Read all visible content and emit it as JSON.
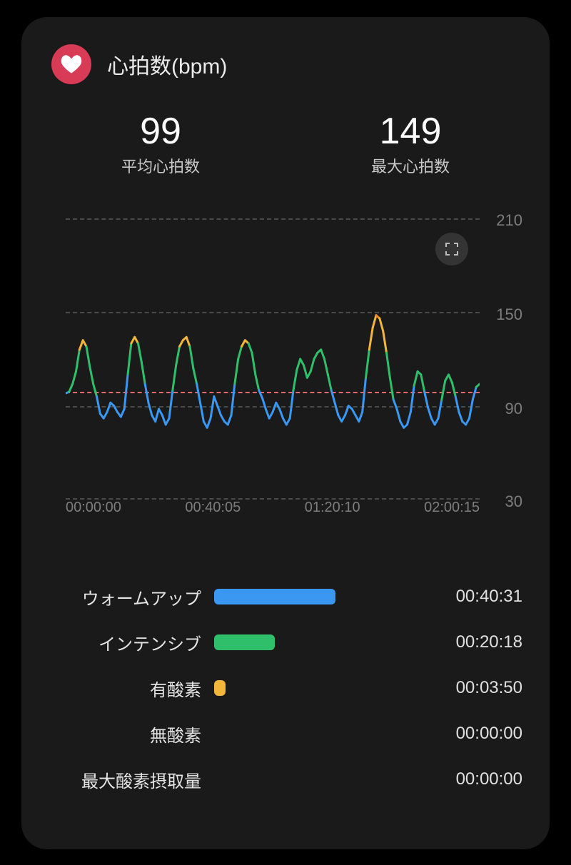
{
  "header": {
    "icon": "heart-icon",
    "title": "心拍数(bpm)"
  },
  "stats": {
    "avg": {
      "value": "99",
      "label": "平均心拍数"
    },
    "max": {
      "value": "149",
      "label": "最大心拍数"
    }
  },
  "chart_data": {
    "type": "line",
    "title": "",
    "xlabel": "",
    "ylabel": "",
    "ylim": [
      30,
      210
    ],
    "yticks": [
      "210",
      "150",
      "90",
      "30"
    ],
    "xticks": [
      "00:00:00",
      "00:40:05",
      "01:20:10",
      "02:00:15"
    ],
    "avg_line": 99,
    "color_thresholds": [
      {
        "below": 100,
        "color": "#3a97f2"
      },
      {
        "below": 128,
        "color": "#2fbf6a"
      },
      {
        "below": 145,
        "color": "#f1b63a"
      },
      {
        "below": 210,
        "color": "#ef8a2c"
      }
    ],
    "x": [
      0,
      1,
      2,
      3,
      4,
      5,
      6,
      7,
      8,
      9,
      10,
      11,
      12,
      13,
      14,
      15,
      16,
      17,
      18,
      19,
      20,
      21,
      22,
      23,
      24,
      25,
      26,
      27,
      28,
      29,
      30,
      31,
      32,
      33,
      34,
      35,
      36,
      37,
      38,
      39,
      40,
      41,
      42,
      43,
      44,
      45,
      46,
      47,
      48,
      49,
      50,
      51,
      52,
      53,
      54,
      55,
      56,
      57,
      58,
      59,
      60,
      61,
      62,
      63,
      64,
      65,
      66,
      67,
      68,
      69,
      70,
      71,
      72,
      73,
      74,
      75,
      76,
      77,
      78,
      79,
      80,
      81,
      82,
      83,
      84,
      85,
      86,
      87,
      88,
      89,
      90,
      91,
      92,
      93,
      94,
      95,
      96,
      97,
      98,
      99,
      100,
      101,
      102,
      103,
      104,
      105,
      106,
      107,
      108,
      109,
      110,
      111,
      112,
      113,
      114,
      115,
      116,
      117,
      118,
      119,
      120
    ],
    "values": [
      98,
      99,
      104,
      112,
      126,
      132,
      128,
      115,
      104,
      96,
      85,
      82,
      86,
      92,
      90,
      86,
      83,
      88,
      110,
      130,
      134,
      130,
      118,
      104,
      92,
      84,
      80,
      88,
      84,
      78,
      82,
      100,
      116,
      128,
      132,
      134,
      128,
      114,
      104,
      92,
      80,
      76,
      82,
      96,
      90,
      84,
      80,
      78,
      84,
      104,
      120,
      128,
      132,
      130,
      124,
      110,
      100,
      95,
      88,
      82,
      86,
      92,
      88,
      82,
      78,
      82,
      100,
      113,
      120,
      116,
      108,
      112,
      120,
      124,
      126,
      120,
      110,
      100,
      92,
      84,
      80,
      84,
      90,
      88,
      84,
      80,
      86,
      108,
      126,
      140,
      148,
      146,
      138,
      124,
      108,
      94,
      88,
      80,
      76,
      78,
      86,
      103,
      112,
      110,
      99,
      89,
      82,
      78,
      82,
      94,
      106,
      110,
      105,
      96,
      86,
      80,
      78,
      82,
      94,
      102,
      104
    ]
  },
  "zones": [
    {
      "label": "ウォームアップ",
      "duration_sec": 2431,
      "time": "00:40:31",
      "color": "#3a97f2"
    },
    {
      "label": "インテンシブ",
      "duration_sec": 1218,
      "time": "00:20:18",
      "color": "#2fbf6a"
    },
    {
      "label": "有酸素",
      "duration_sec": 230,
      "time": "00:03:50",
      "color": "#f1b63a"
    },
    {
      "label": "無酸素",
      "duration_sec": 0,
      "time": "00:00:00",
      "color": "#ef8a2c"
    },
    {
      "label": "最大酸素摂取量",
      "duration_sec": 0,
      "time": "00:00:00",
      "color": "#e34a4a"
    }
  ]
}
